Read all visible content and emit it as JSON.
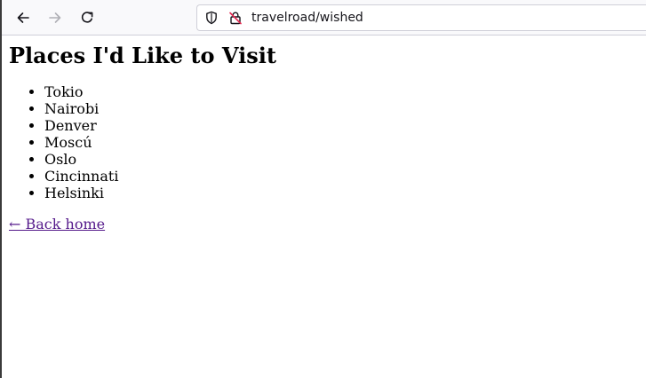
{
  "browser": {
    "url": "travelroad/wished",
    "back_icon": "arrow-left-icon",
    "forward_icon": "arrow-right-icon",
    "reload_icon": "reload-icon",
    "shield_icon": "shield-icon",
    "lock_icon": "insecure-lock-icon"
  },
  "page": {
    "title": "Places I'd Like to Visit",
    "places": [
      "Tokio",
      "Nairobi",
      "Denver",
      "Moscú",
      "Oslo",
      "Cincinnati",
      "Helsinki"
    ],
    "back_link": "← Back home"
  },
  "colors": {
    "visited_link": "#551a8b",
    "toolbar_bg": "#f9f9fb",
    "insecure_slash": "#e22850"
  }
}
